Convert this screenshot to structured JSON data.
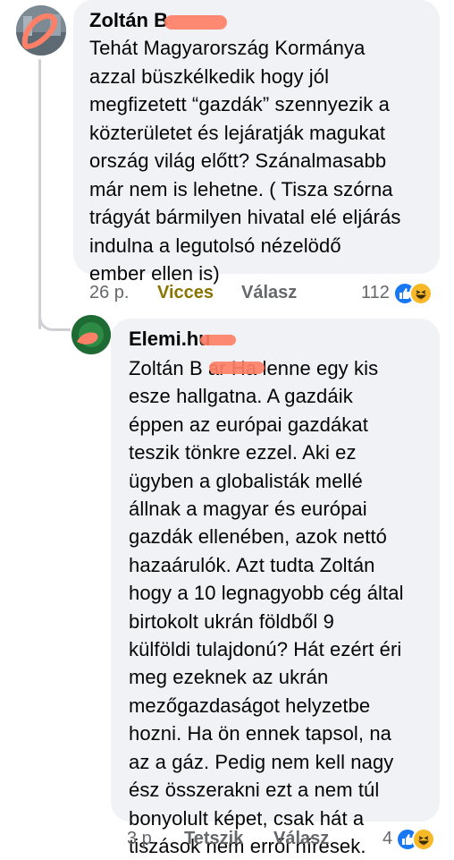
{
  "comment": {
    "author": "Zoltán B",
    "text": "Tehát Magyarország Kormánya\nazzal büszkélkedik hogy jól\nmegfizetett “gazdák” szennyezik a\nközterületet és lejáratják magukat\nország világ előtt? Szánalmasabb\nmár nem is lehetne. ( Tisza szórna\ntrágyát bármilyen hivatal elé eljárás\nindulna a legutolsó nézelödő\nember ellen is)",
    "time": "26 p.",
    "reaction_action": "Vicces",
    "reply_action": "Válasz",
    "reaction_count": "112",
    "reaction_icons": [
      "like-icon",
      "haha-icon"
    ]
  },
  "reply": {
    "author": "Elemi.hu",
    "text": "Zoltán B      ar Ha lenne egy kis\nesze hallgatna. A gazdáik\néppen az európai gazdákat\nteszik tönkre ezzel. Aki ez\nügyben a globalisták mellé\nállnak a magyar és európai\ngazdák ellenében, azok nettó\nhazaárulók. Azt tudta Zoltán\nhogy a 10 legnagyobb cég által\nbirtokolt ukrán földből 9\nkülföldi tulajdonú? Hát ezért éri\nmeg ezeknek az ukrán\nmezőgazdaságot helyzetbe\nhozni. Ha ön ennek tapsol, na\naz a gáz. Pedig nem kell nagy\nész összerakni ezt a nem túl\nbonyolult képet, csak hát a\ntiszások nem erről híresek.",
    "time": "3 p.",
    "like_action": "Tetszik",
    "reply_action": "Válasz",
    "reaction_count": "4",
    "reaction_icons": [
      "like-icon",
      "haha-icon"
    ]
  },
  "colors": {
    "bubble": "#f0f2f5",
    "meta_text": "#65676b",
    "funny_reaction": "#8a7400",
    "redaction": "#ff8066",
    "like_blue": "#1877f2",
    "haha_yellow": "#f7b928"
  }
}
